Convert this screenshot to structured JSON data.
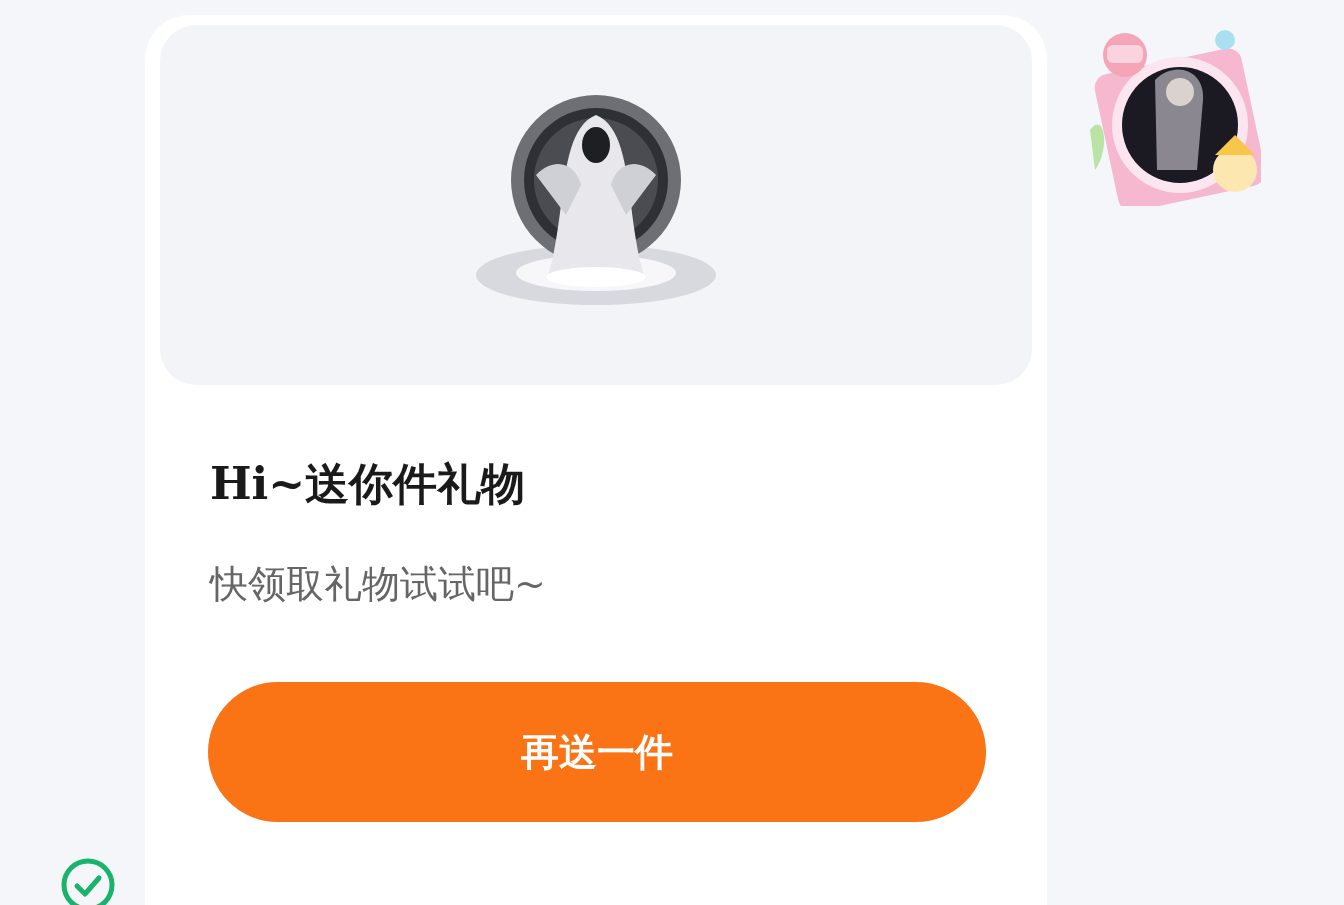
{
  "gift_card": {
    "title": "Hi~送你件礼物",
    "subtitle": "快领取礼物试试吧~",
    "button": "再送一件"
  },
  "status": {
    "checked": true
  }
}
